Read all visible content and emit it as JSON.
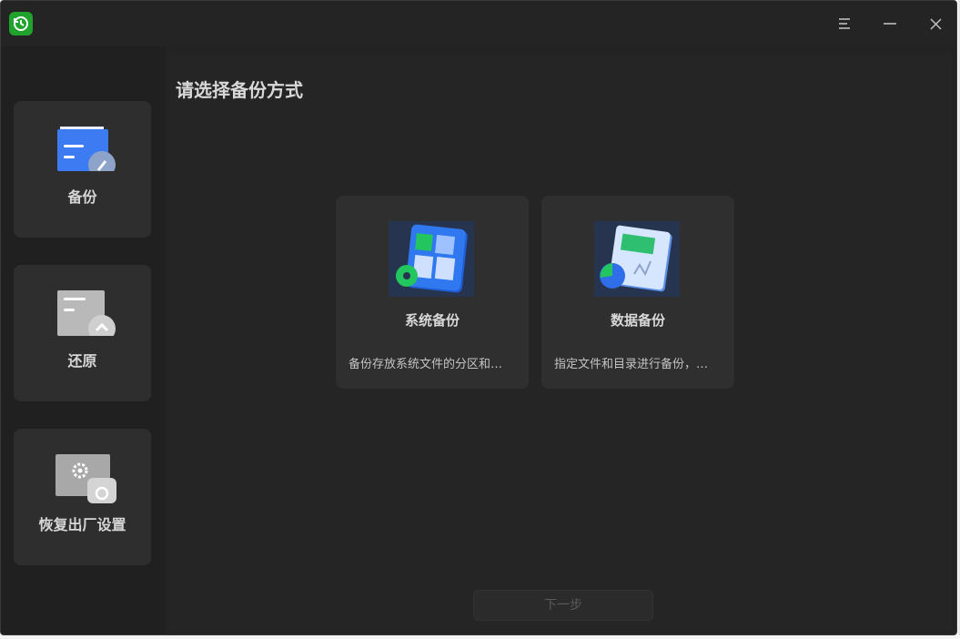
{
  "window": {
    "controls": {
      "menu": "menu-icon",
      "minimize": "minimize-icon",
      "close": "close-icon"
    }
  },
  "sidebar": {
    "items": [
      {
        "label": "备份",
        "icon": "backup-folder-icon",
        "selected": true
      },
      {
        "label": "还原",
        "icon": "restore-folder-icon",
        "selected": false
      },
      {
        "label": "恢复出厂设置",
        "icon": "factory-reset-icon",
        "selected": false
      }
    ]
  },
  "main": {
    "title": "请选择备份方式",
    "cards": [
      {
        "title": "系统备份",
        "desc": "备份存放系统文件的分区和…",
        "icon": "system-backup-icon"
      },
      {
        "title": "数据备份",
        "desc": "指定文件和目录进行备份，…",
        "icon": "data-backup-icon"
      }
    ],
    "next_label": "下一步"
  },
  "colors": {
    "window_bg": "#232323",
    "sidebar_bg": "#202020",
    "card_bg": "#2f2f2f",
    "accent_green": "#1fa32c",
    "accent_blue": "#2f6ee8"
  }
}
